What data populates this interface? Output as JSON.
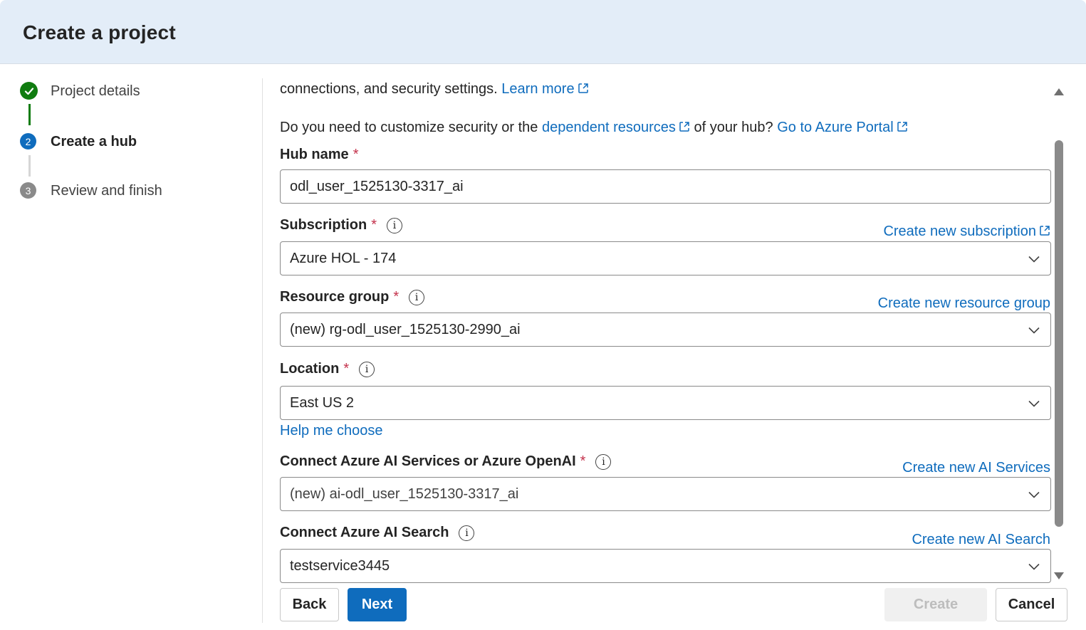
{
  "header": {
    "title": "Create a project"
  },
  "stepper": [
    {
      "number": "",
      "label": "Project details",
      "state": "done"
    },
    {
      "number": "2",
      "label": "Create a hub",
      "state": "active"
    },
    {
      "number": "3",
      "label": "Review and finish",
      "state": "todo"
    }
  ],
  "intro": {
    "line1_text": "connections, and security settings.",
    "line1_link": "Learn more",
    "line2_prefix": "Do you need to customize security or the",
    "line2_link1": "dependent resources",
    "line2_middle": "of your hub?",
    "line2_link2": "Go to Azure Portal"
  },
  "fields": {
    "hub_name": {
      "label": "Hub name",
      "required": "*",
      "value": "odl_user_1525130-3317_ai"
    },
    "subscription": {
      "label": "Subscription",
      "required": "*",
      "info": "i",
      "link": "Create new subscription",
      "value": "Azure HOL - 174"
    },
    "resource_group": {
      "label": "Resource group",
      "required": "*",
      "info": "i",
      "link": "Create new resource group",
      "value": "(new) rg-odl_user_1525130-2990_ai"
    },
    "location": {
      "label": "Location",
      "required": "*",
      "info": "i",
      "value": "East US 2",
      "help_link": "Help me choose"
    },
    "ai_services": {
      "label": "Connect Azure AI Services or Azure OpenAI",
      "required": "*",
      "info": "i",
      "link": "Create new AI Services",
      "value": "(new) ai-odl_user_1525130-3317_ai"
    },
    "ai_search": {
      "label": "Connect Azure AI Search",
      "info": "i",
      "link": "Create new AI Search",
      "value": "testservice3445"
    }
  },
  "buttons": {
    "back": "Back",
    "next": "Next",
    "create": "Create",
    "cancel": "Cancel"
  },
  "colors": {
    "accent": "#0f6cbd",
    "success": "#107c10",
    "required": "#c4314b",
    "header_bg": "#e3edf8"
  }
}
